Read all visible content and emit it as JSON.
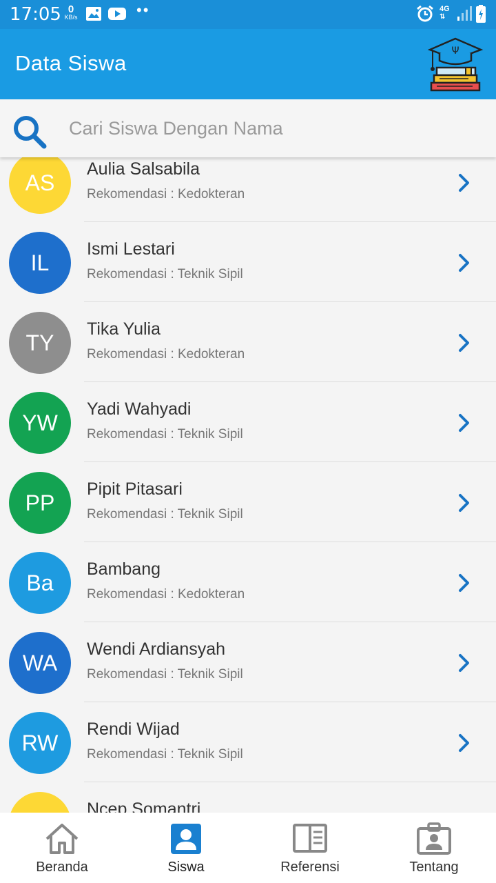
{
  "status_bar": {
    "time": "17:05",
    "net_speed_value": "0",
    "net_speed_unit": "KB/s",
    "network_type": "4G",
    "icons": [
      "image-icon",
      "youtube-icon",
      "alarm-icon",
      "signal-icon",
      "battery-icon"
    ]
  },
  "app_bar": {
    "title": "Data Siswa",
    "logo_icon": "graduation-books-icon"
  },
  "search": {
    "placeholder": "Cari Siswa Dengan Nama",
    "value": "",
    "icon": "search-icon"
  },
  "students": [
    {
      "initials": "AS",
      "name": "Aulia Salsabila",
      "recommendation": "Rekomendasi : Kedokteran",
      "color": "#FDD835"
    },
    {
      "initials": "IL",
      "name": "Ismi Lestari",
      "recommendation": "Rekomendasi : Teknik Sipil",
      "color": "#1E6FCC"
    },
    {
      "initials": "TY",
      "name": "Tika Yulia",
      "recommendation": "Rekomendasi : Kedokteran",
      "color": "#8E8E8E"
    },
    {
      "initials": "YW",
      "name": "Yadi Wahyadi",
      "recommendation": "Rekomendasi : Teknik Sipil",
      "color": "#13A352"
    },
    {
      "initials": "PP",
      "name": "Pipit Pitasari",
      "recommendation": "Rekomendasi : Teknik Sipil",
      "color": "#13A352"
    },
    {
      "initials": "Ba",
      "name": "Bambang",
      "recommendation": "Rekomendasi : Kedokteran",
      "color": "#1E9BE0"
    },
    {
      "initials": "WA",
      "name": "Wendi Ardiansyah",
      "recommendation": "Rekomendasi : Teknik Sipil",
      "color": "#1E6FCC"
    },
    {
      "initials": "RW",
      "name": "Rendi Wijad",
      "recommendation": "Rekomendasi : Teknik Sipil",
      "color": "#1E9BE0"
    },
    {
      "initials": "",
      "name": "Ncep Somantri",
      "recommendation": "",
      "color": "#FDD835"
    }
  ],
  "bottom_nav": {
    "active": "Siswa",
    "active_color": "#1A80D0",
    "inactive_color": "#888888",
    "items": [
      {
        "label": "Beranda",
        "icon": "home-icon"
      },
      {
        "label": "Siswa",
        "icon": "person-icon"
      },
      {
        "label": "Referensi",
        "icon": "book-icon"
      },
      {
        "label": "Tentang",
        "icon": "id-badge-icon"
      }
    ]
  }
}
